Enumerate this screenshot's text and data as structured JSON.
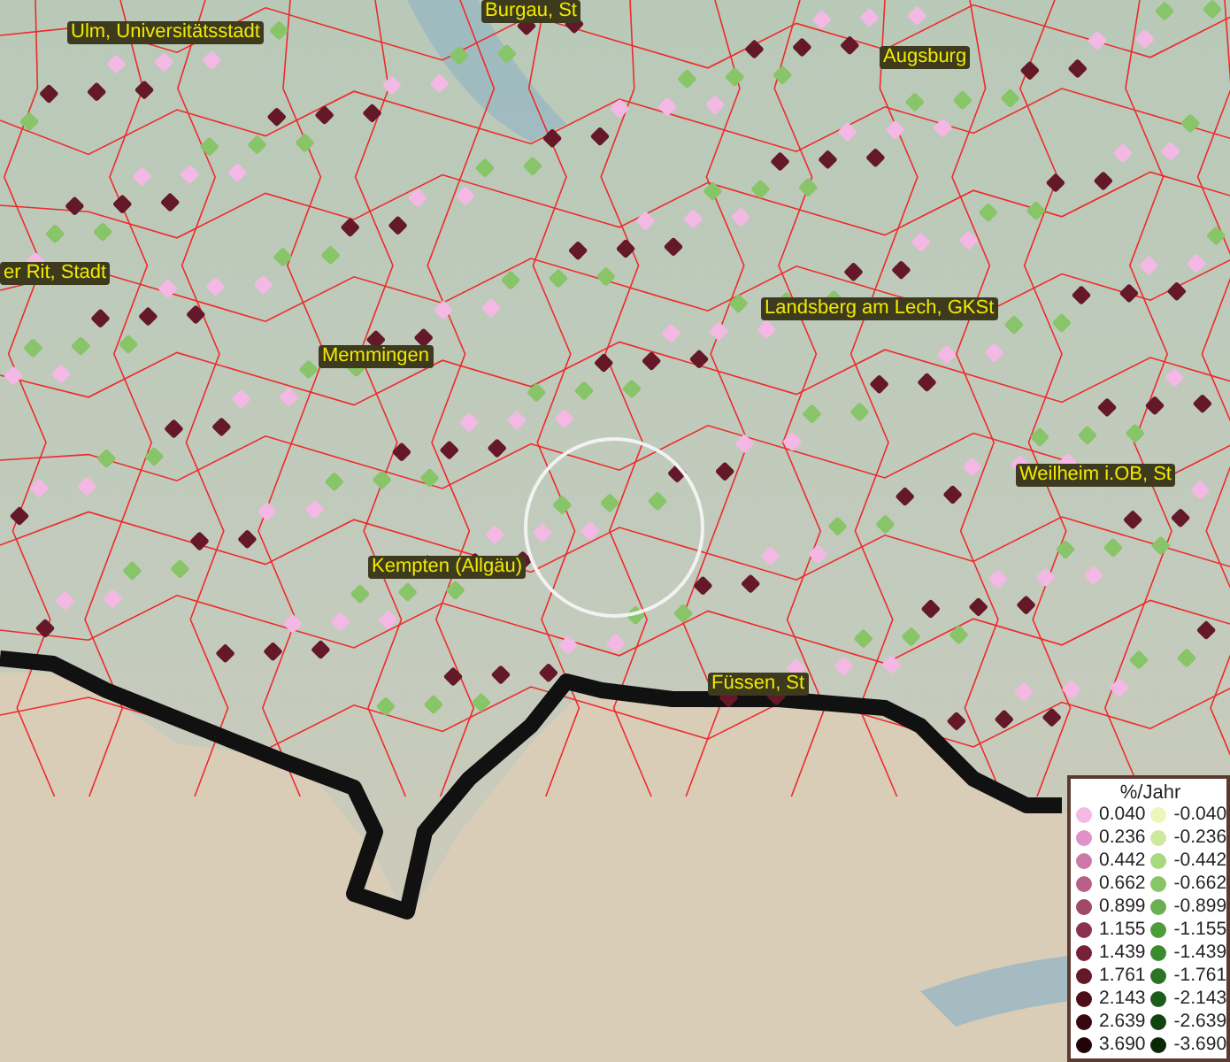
{
  "map": {
    "place_labels": [
      {
        "text": "Ulm, Universitätsstadt"
      },
      {
        "text": "Burgau, St"
      },
      {
        "text": "Augsburg"
      },
      {
        "text": "er Rit, Stadt"
      },
      {
        "text": "Landsberg am Lech, GKSt"
      },
      {
        "text": "Memmingen"
      },
      {
        "text": "Weilheim i.OB, St"
      },
      {
        "text": "Kempten (Allgäu)"
      },
      {
        "text": "Füssen, St"
      }
    ]
  },
  "legend": {
    "title": "%/Jahr",
    "entries": [
      {
        "value": "0.040",
        "color": "#f4b8e4"
      },
      {
        "value": "-0.040",
        "color": "#eef5b8"
      },
      {
        "value": "0.236",
        "color": "#e092c8"
      },
      {
        "value": "-0.236",
        "color": "#cfe8a0"
      },
      {
        "value": "0.442",
        "color": "#cc78a8"
      },
      {
        "value": "-0.442",
        "color": "#a8d880"
      },
      {
        "value": "0.662",
        "color": "#b86088"
      },
      {
        "value": "-0.662",
        "color": "#88c468"
      },
      {
        "value": "0.899",
        "color": "#a04868"
      },
      {
        "value": "-0.899",
        "color": "#68b050"
      },
      {
        "value": "1.155",
        "color": "#8c3050"
      },
      {
        "value": "-1.155",
        "color": "#4c9c3c"
      },
      {
        "value": "1.439",
        "color": "#782038"
      },
      {
        "value": "-1.439",
        "color": "#3a8a30"
      },
      {
        "value": "1.761",
        "color": "#641828"
      },
      {
        "value": "-1.761",
        "color": "#2a7424"
      },
      {
        "value": "2.143",
        "color": "#4c0c18"
      },
      {
        "value": "-2.143",
        "color": "#1a5c18"
      },
      {
        "value": "2.639",
        "color": "#380810"
      },
      {
        "value": "-2.639",
        "color": "#104410"
      },
      {
        "value": "3.690",
        "color": "#200408"
      },
      {
        "value": "-3.690",
        "color": "#082808"
      }
    ]
  }
}
